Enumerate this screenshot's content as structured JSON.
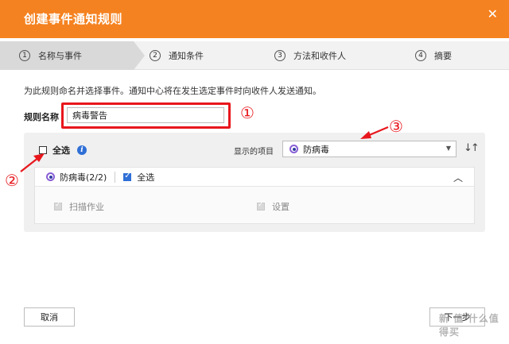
{
  "window": {
    "title": "创建事件通知规则",
    "close_glyph": "✕"
  },
  "steps": [
    {
      "num": "1",
      "label": "名称与事件"
    },
    {
      "num": "2",
      "label": "通知条件"
    },
    {
      "num": "3",
      "label": "方法和收件人"
    },
    {
      "num": "4",
      "label": "摘要"
    }
  ],
  "description": "为此规则命名并选择事件。通知中心将在发生选定事件时向收件人发送通知。",
  "rule_name": {
    "label": "规则名称",
    "value": "病毒警告"
  },
  "annotations": {
    "a1": "①",
    "a2": "②",
    "a3": "③"
  },
  "event_panel": {
    "select_all_label": "全选",
    "info_glyph": "i",
    "shown_items_label": "显示的项目",
    "dropdown_value": "防病毒",
    "sort_glyph": "↓↑",
    "group": {
      "name": "防病毒(2/2)",
      "select_all_label": "全选",
      "items": [
        {
          "label": "扫描作业"
        },
        {
          "label": "设置"
        }
      ]
    }
  },
  "footer": {
    "cancel_label": "取消",
    "next_label": "下一步"
  },
  "watermark": "新 值·什么值得买",
  "colors": {
    "titlebar": "#f58220",
    "accent": "#2f6fd6",
    "annotation": "#e8161c"
  }
}
